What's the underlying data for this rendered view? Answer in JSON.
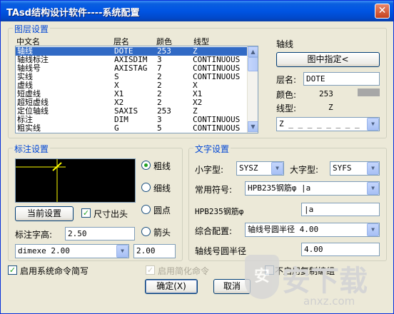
{
  "window": {
    "title": "TAsd结构设计软件----系统配置",
    "close_label": "✕"
  },
  "layer": {
    "legend": "图层设置",
    "headers": {
      "cn": "中文名",
      "layer": "层名",
      "color": "颜色",
      "linetype": "线型"
    },
    "rows": [
      {
        "cn": "轴线",
        "layer": "DOTE",
        "color": "253",
        "linetype": "Z"
      },
      {
        "cn": "轴线标注",
        "layer": "AXISDIM",
        "color": "3",
        "linetype": "CONTINUOUS"
      },
      {
        "cn": "轴线号",
        "layer": "AXISTAG",
        "color": "7",
        "linetype": "CONTINUOUS"
      },
      {
        "cn": "实线",
        "layer": "S",
        "color": "2",
        "linetype": "CONTINUOUS"
      },
      {
        "cn": "虚线",
        "layer": "X",
        "color": "2",
        "linetype": "X"
      },
      {
        "cn": "短虚线",
        "layer": "X1",
        "color": "2",
        "linetype": "X1"
      },
      {
        "cn": "超短虚线",
        "layer": "X2",
        "color": "2",
        "linetype": "X2"
      },
      {
        "cn": "定位轴线",
        "layer": "SAXIS",
        "color": "253",
        "linetype": "Z"
      },
      {
        "cn": "标注",
        "layer": "DIM",
        "color": "3",
        "linetype": "CONTINUOUS"
      },
      {
        "cn": "粗实线",
        "layer": "G",
        "color": "5",
        "linetype": "CONTINUOUS"
      }
    ],
    "selected_index": 0
  },
  "axis_panel": {
    "title": "轴线",
    "pick_button": "图中指定<",
    "layer_label": "层名:",
    "layer_value": "DOTE",
    "color_label": "颜色:",
    "color_value": "253",
    "color_swatch": "#a7a7a7",
    "linetype_label": "线型:",
    "linetype_value": "Z",
    "linetype_combo": "Z _ _ _ _ _ _ _ _"
  },
  "dim": {
    "legend": "标注设置",
    "radio_options": [
      "粗线",
      "细线",
      "圆点",
      "箭头"
    ],
    "selected_radio": 0,
    "current_button": "当前设置",
    "size_exceed_label": "尺寸出头",
    "size_exceed_checked": true,
    "text_height_label": "标注字高:",
    "text_height_value": "2.50",
    "dimexe_combo": "dimexe 2.00",
    "dimexe_value": "2.00"
  },
  "text": {
    "legend": "文字设置",
    "small_font_label": "小字型:",
    "small_font_value": "SYSZ",
    "big_font_label": "大字型:",
    "big_font_value": "SYFS",
    "symbol_label": "常用符号:",
    "symbol_value": "HPB235钢筋φ  |a",
    "symbol_field_label": "HPB235钢筋φ",
    "symbol_field_value": "|a",
    "config_label": "综合配置:",
    "config_value": "轴线号圆半径 4.00",
    "radius_label": "轴线号圆半径",
    "radius_value": "4.00"
  },
  "bottom": {
    "enable_shortcuts_label": "启用系统命令简写",
    "enable_shortcuts_checked": true,
    "enable_simplified_label": "启用简化命令",
    "disable_copy_label": "不启用复制编组",
    "ok_button": "确定(X)",
    "cancel_button": "取消"
  },
  "watermark": {
    "logo_text": "安",
    "brand": "安下载",
    "url": "anxz.com"
  },
  "colors": {
    "title_bar": "#0054e3",
    "legend_blue": "#0046d5",
    "selection": "#316ac5",
    "check_green": "#21a121"
  }
}
